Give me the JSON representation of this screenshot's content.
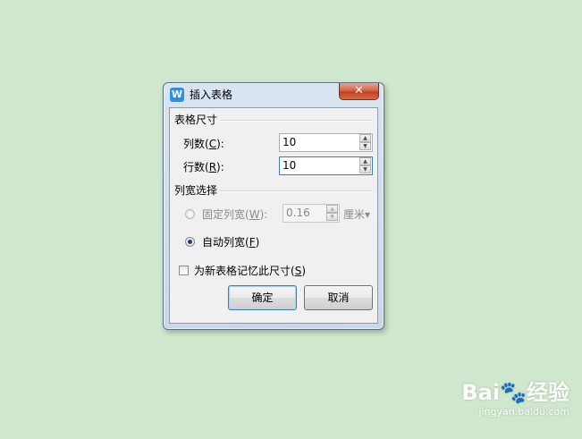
{
  "dialog": {
    "title": "插入表格",
    "icon": "W",
    "close_glyph": "✕"
  },
  "table_size": {
    "group_title": "表格尺寸",
    "columns": {
      "label": "列数(",
      "mnemonic": "C",
      "suffix": "):",
      "value": "10"
    },
    "rows": {
      "label": "行数(",
      "mnemonic": "R",
      "suffix": "):",
      "value": "10"
    }
  },
  "column_width": {
    "group_title": "列宽选择",
    "fixed": {
      "label": "固定列宽(",
      "mnemonic": "W",
      "suffix": "):",
      "value": "0.16",
      "unit": "厘米▾",
      "checked": false,
      "enabled": false
    },
    "auto": {
      "label": "自动列宽(",
      "mnemonic": "F",
      "suffix": ")",
      "checked": true
    }
  },
  "remember": {
    "label": "为新表格记忆此尺寸(",
    "mnemonic": "S",
    "suffix": ")",
    "checked": false
  },
  "buttons": {
    "ok": "确定",
    "cancel": "取消"
  },
  "watermark": {
    "main": "Bai🐾经验",
    "sub": "jingyan.baidu.com"
  }
}
